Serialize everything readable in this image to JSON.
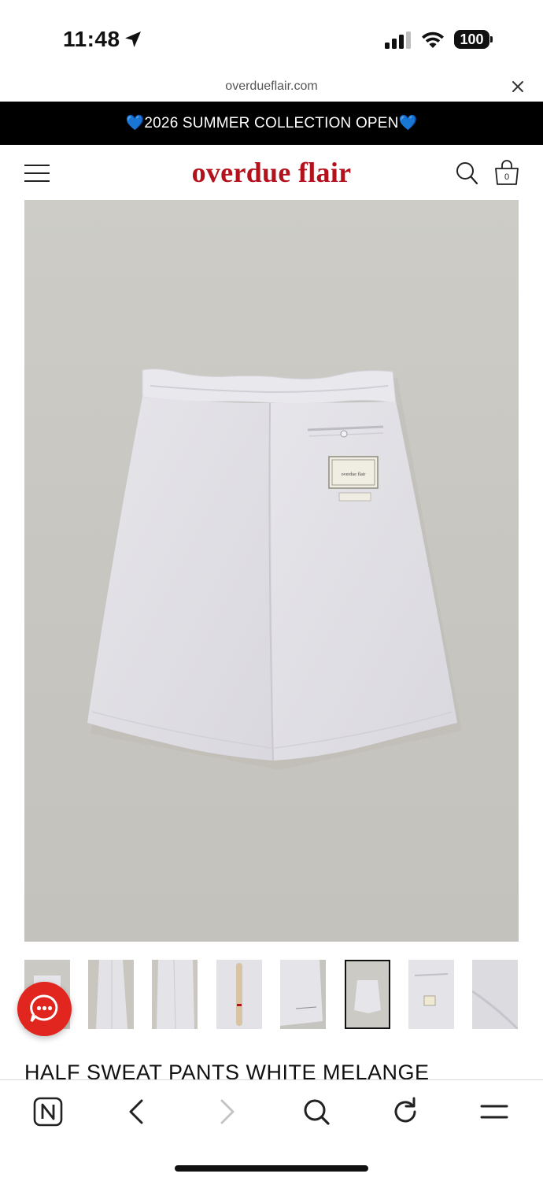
{
  "status_bar": {
    "time": "11:48",
    "battery": "100",
    "icons": [
      "location-arrow-icon",
      "signal-icon",
      "wifi-icon",
      "battery-icon"
    ]
  },
  "browser": {
    "url": "overdueflair.com",
    "close_icon": "close-icon"
  },
  "promo": {
    "text": "💙2026 SUMMER COLLECTION OPEN💙"
  },
  "header": {
    "logo": "overdue flair",
    "cart_count": "0",
    "icons": [
      "hamburger-menu-icon",
      "search-icon",
      "shopping-bag-icon"
    ],
    "logo_color": "#b3121c"
  },
  "product": {
    "label_brand": "overdue flair",
    "title": "HALF SWEAT PANTS  WHITE MELANGE",
    "thumbnail_count": 8,
    "active_thumbnail": 6
  },
  "chat": {
    "icon": "chat-bubble-icon",
    "color": "#e0261e"
  },
  "toolbar": {
    "icons": [
      "naver-home-icon",
      "back-icon",
      "forward-icon",
      "search-icon",
      "reload-icon",
      "menu-icon"
    ]
  }
}
